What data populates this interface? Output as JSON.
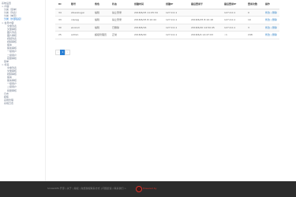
{
  "sidebar": {
    "items": [
      "系统设置",
      "> 内容",
      "分类（菜单）",
      "分类（列表）",
      "分类（单页）",
      "分类（外部链接）",
      "> 会员内容",
      "文章列表",
      "文章审核",
      "图片列表",
      "图片审核",
      "视频列表",
      "视频审核",
      "留言",
      "留言审核",
      "一级用户",
      "二级用户",
      "批量审核",
      "菜单",
      "> 标签",
      "文章列表",
      "文章审核",
      "视频审核",
      "留言",
      "留言审核",
      "一级用户",
      "二级用户",
      "批量审核",
      "日志",
      "模板",
      "系统管理",
      "系统日志"
    ],
    "selected_index": 5
  },
  "table": {
    "columns": [
      "ID",
      "账号",
      "角色",
      "状态",
      "创建时间",
      "创建IP",
      "最后登录于",
      "最后登录IP",
      "登录次数",
      "操作"
    ],
    "rows": [
      [
        "34",
        "ziliaoxiugai",
        "编辑",
        "禁止登录",
        "2018/6/25 11:05:34",
        "127.0.0.1",
        "",
        "127.0.0.1",
        "0",
        "修改 | 删除"
      ],
      [
        "33",
        "xiaoqg",
        "编辑",
        "禁止登录",
        "2018/6/25 8:10:44",
        "127.0.0.1",
        "2018/6/25 8:10:18",
        "127.0.0.1",
        "10",
        "修改 | 删除"
      ],
      [
        "30",
        "wuxiuli",
        "编辑",
        "已删除",
        "2018/6/16",
        "127.0.0.1",
        "2018/6/20 14:50:45",
        "127.0.0.1",
        "3",
        "修改 | 删除"
      ],
      [
        "25",
        "admin",
        "超级管理员",
        "正常",
        "2018/6/20",
        "127.0.0.1",
        "2018/6/4 14:47:03",
        "::1",
        "248",
        "修改 | 删除"
      ]
    ]
  },
  "pagination": {
    "prev": "‹",
    "current": "1",
    "next": "›"
  },
  "footer": {
    "text": "SmileCMS 开源 | 关于 | 版权 | 免费授权联系方式 | 问题反馈 | 联系我们 >",
    "powered": "Powered by"
  },
  "colors": {
    "accent": "#2a7fd4",
    "footer_bg": "#2c2c2c",
    "footer_logo": "#d9342b"
  }
}
